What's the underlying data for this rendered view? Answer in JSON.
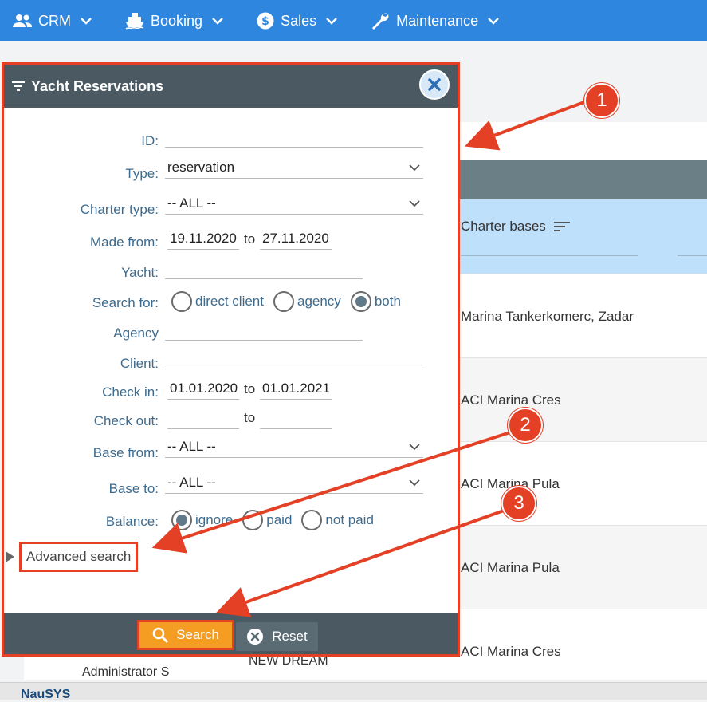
{
  "nav": {
    "items": [
      {
        "label": "CRM",
        "icon": "people-icon"
      },
      {
        "label": "Booking",
        "icon": "ship-icon"
      },
      {
        "label": "Sales",
        "icon": "dollar-icon"
      },
      {
        "label": "Maintenance",
        "icon": "wrench-icon"
      }
    ]
  },
  "background": {
    "column_header": "Charter bases",
    "rows": [
      "Marina Tankerkomerc, Zadar",
      "ACI Marina Cres",
      "ACI Marina Pula",
      "ACI Marina Pula",
      "ACI Marina Cres"
    ],
    "bottom_left": "Administrator S",
    "bottom_mid": "NEW DREAM",
    "footer_logo": "NauSYS"
  },
  "panel": {
    "title": "Yacht Reservations",
    "labels": {
      "id": "ID:",
      "type": "Type:",
      "charter_type": "Charter type:",
      "made_from": "Made from:",
      "yacht": "Yacht:",
      "search_for": "Search for:",
      "agency": "Agency",
      "client": "Client:",
      "check_in": "Check in:",
      "check_out": "Check out:",
      "base_from": "Base from:",
      "base_to": "Base to:",
      "balance": "Balance:",
      "to": "to"
    },
    "values": {
      "id": "",
      "type": "reservation",
      "charter_type": "-- ALL --",
      "made_from": "19.11.2020",
      "made_to": "27.11.2020",
      "yacht": "",
      "agency": "",
      "client": "",
      "check_in_from": "01.01.2020",
      "check_in_to": "01.01.2021",
      "check_out_from": "",
      "check_out_to": "",
      "base_from": "-- ALL --",
      "base_to": "-- ALL --"
    },
    "search_for_options": [
      "direct client",
      "agency",
      "both"
    ],
    "search_for_selected": "both",
    "balance_options": [
      "ignore",
      "paid",
      "not paid"
    ],
    "balance_selected": "ignore",
    "advanced_search": "Advanced search",
    "search_button": "Search",
    "reset_button": "Reset"
  },
  "annotations": [
    "1",
    "2",
    "3"
  ],
  "colors": {
    "nav": "#2f86de",
    "panel_header": "#4b5a62",
    "highlight": "#e34026",
    "search_button": "#f59d22",
    "label": "#3e6b8e"
  }
}
